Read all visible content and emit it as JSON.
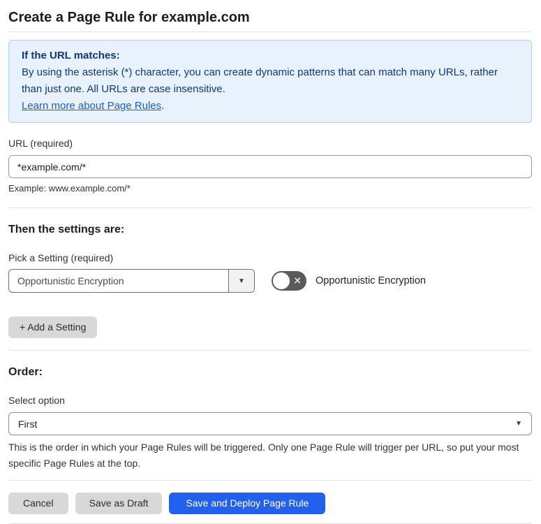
{
  "page": {
    "title": "Create a Page Rule for example.com"
  },
  "info_box": {
    "heading": "If the URL matches:",
    "body": "By using the asterisk (*) character, you can create dynamic patterns that can match many URLs, rather than just one. All URLs are case insensitive.",
    "link_label": "Learn more about Page Rules",
    "link_suffix": "."
  },
  "url_field": {
    "label": "URL (required)",
    "value": "*example.com/*",
    "helper": "Example: www.example.com/*"
  },
  "settings_section": {
    "heading": "Then the settings are:",
    "pick_setting_label": "Pick a Setting (required)",
    "selected_setting": "Opportunistic Encryption",
    "toggle_label": "Opportunistic Encryption",
    "toggle_state": "off",
    "add_setting_button": "+ Add a Setting"
  },
  "order_section": {
    "heading": "Order:",
    "select_label": "Select option",
    "selected_option": "First",
    "helper": "This is the order in which your Page Rules will be triggered. Only one Page Rule will trigger per URL, so put your most specific Page Rules at the top."
  },
  "actions": {
    "cancel": "Cancel",
    "save_draft": "Save as Draft",
    "save_deploy": "Save and Deploy Page Rule"
  },
  "icons": {
    "dropdown_arrow": "▼",
    "toggle_x": "✕"
  },
  "colors": {
    "info_bg": "#e8f2fc",
    "info_border": "#a9d1f7",
    "info_text": "#0e3680",
    "link_blue": "#1a5dd6",
    "primary_button_blue": "#2161ee",
    "toggle_off_gray": "#5a5a5a",
    "secondary_button_gray": "#d8d8d8"
  }
}
